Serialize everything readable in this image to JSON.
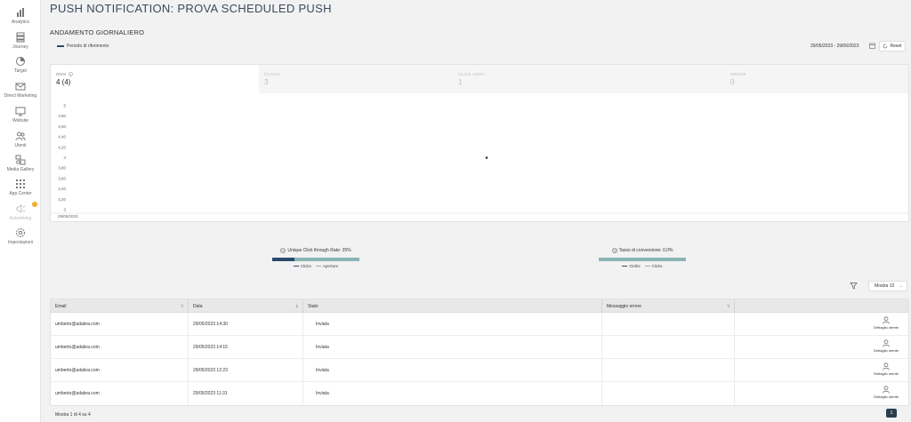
{
  "sidebar": {
    "items": [
      {
        "label": "Analytics",
        "icon": "bar-chart-icon"
      },
      {
        "label": "Journey",
        "icon": "journey-icon"
      },
      {
        "label": "Target",
        "icon": "pie-chart-icon"
      },
      {
        "label": "Direct Marketing",
        "icon": "mail-icon"
      },
      {
        "label": "Website",
        "icon": "monitor-icon"
      },
      {
        "label": "Utenti",
        "icon": "users-icon"
      },
      {
        "label": "Media Gallery",
        "icon": "media-icon"
      },
      {
        "label": "App Center",
        "icon": "grid-icon"
      },
      {
        "label": "Advertising",
        "icon": "megaphone-icon"
      },
      {
        "label": "Impostazioni",
        "icon": "gear-icon"
      }
    ]
  },
  "page": {
    "title": "PUSH NOTIFICATION: PROVA SCHEDULED PUSH"
  },
  "daily": {
    "title": "ANDAMENTO GIORNALIERO",
    "legend": "Periodo di riferimento",
    "date_range": "29/05/2023 - 29/06/2023",
    "reset_label": "Reset"
  },
  "kpis": [
    {
      "label": "INVII",
      "value": "4 (4)"
    },
    {
      "label": "CLICKS",
      "value": "3"
    },
    {
      "label": "CLICK UNICI",
      "value": "1"
    },
    {
      "label": "ORDINI",
      "value": "0"
    }
  ],
  "chart_data": {
    "type": "scatter",
    "x": [
      "29/05/2023"
    ],
    "y_ticks": [
      "5",
      "4,80",
      "4,60",
      "4,40",
      "4,20",
      "4",
      "3,80",
      "3,60",
      "3,40",
      "3,20",
      "3"
    ],
    "ylim": [
      3,
      5
    ],
    "series": [
      {
        "x": [
          "29/05/2023"
        ],
        "values": [
          4
        ]
      }
    ],
    "x_tick_label": "29/05/2023"
  },
  "rates": [
    {
      "title": "Unique Click through Rate: 25%",
      "value": 0.25,
      "legend": [
        "Clicks",
        "Aperture"
      ]
    },
    {
      "title": "Tasso di conversione: 0,0%",
      "value": 0.0,
      "legend": [
        "Ordini",
        "Clicks"
      ]
    }
  ],
  "colors": {
    "primary": "#2a4a6a",
    "secondary": "#8ab4b4"
  },
  "table": {
    "show_label": "Mostra 10",
    "headers": [
      "Email",
      "Data",
      "Stato",
      "Messaggio errore"
    ],
    "rows": [
      {
        "email": "umberto@adabra.com",
        "date": "29/05/2023 14:30",
        "status": "Inviata",
        "error": "",
        "action": "Dettaglio utente"
      },
      {
        "email": "umberto@adabra.com",
        "date": "29/05/2023 14:15",
        "status": "Inviata",
        "error": "",
        "action": "Dettaglio utente"
      },
      {
        "email": "umberto@adabra.com",
        "date": "29/05/2023 12:23",
        "status": "Inviata",
        "error": "",
        "action": "Dettaglio utente"
      },
      {
        "email": "umberto@adabra.com",
        "date": "29/05/2023 11:31",
        "status": "Inviata",
        "error": "",
        "action": "Dettaglio utente"
      }
    ],
    "footer": "Mostra 1 di 4 su 4",
    "current_page": "1"
  }
}
